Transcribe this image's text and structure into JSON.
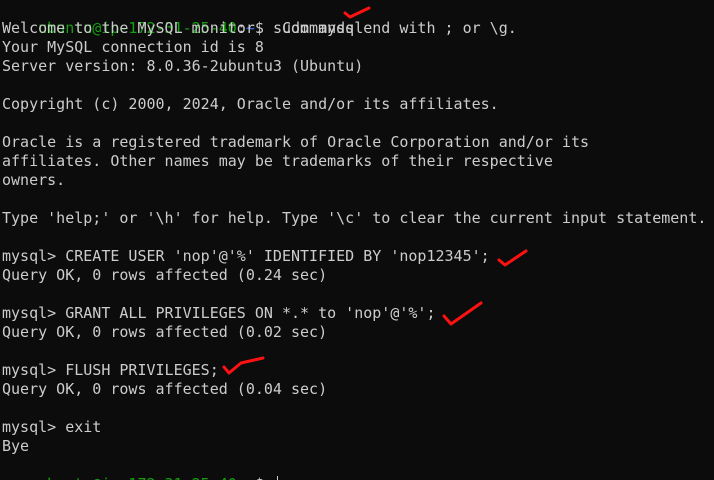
{
  "prompt": {
    "user_host": "ubuntu@ip-172-31-25-40",
    "separator": ":",
    "path": "~",
    "symbol": "$ "
  },
  "lines": [
    "sudo mysql",
    "Welcome to the MySQL monitor.  Commands end with ; or \\g.",
    "Your MySQL connection id is 8",
    "Server version: 8.0.36-2ubuntu3 (Ubuntu)",
    "Copyright (c) 2000, 2024, Oracle and/or its affiliates.",
    "Oracle is a registered trademark of Oracle Corporation and/or its",
    "affiliates. Other names may be trademarks of their respective",
    "owners.",
    "Type 'help;' or '\\h' for help. Type '\\c' to clear the current input statement.",
    "mysql> CREATE USER 'nop'@'%' IDENTIFIED BY 'nop12345';",
    "Query OK, 0 rows affected (0.24 sec)",
    "mysql> GRANT ALL PRIVILEGES ON *.* to 'nop'@'%';",
    "Query OK, 0 rows affected (0.02 sec)",
    "mysql> FLUSH PRIVILEGES;",
    "Query OK, 0 rows affected (0.04 sec)",
    "mysql> exit",
    "Bye"
  ]
}
